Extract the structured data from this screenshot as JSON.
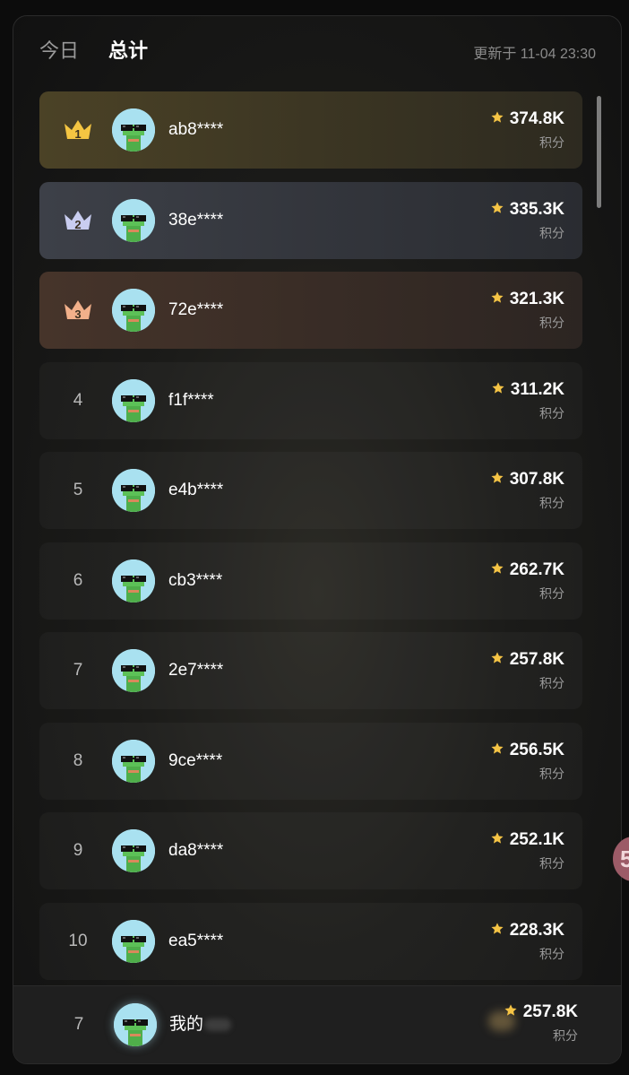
{
  "header": {
    "tabs": [
      {
        "label": "今日"
      },
      {
        "label": "总计"
      }
    ],
    "updated": "更新于 11-04 23:30"
  },
  "score_unit": "积分",
  "entries": [
    {
      "rank": "1",
      "name": "ab8****",
      "score": "374.8K"
    },
    {
      "rank": "2",
      "name": "38e****",
      "score": "335.3K"
    },
    {
      "rank": "3",
      "name": "72e****",
      "score": "321.3K"
    },
    {
      "rank": "4",
      "name": "f1f****",
      "score": "311.2K"
    },
    {
      "rank": "5",
      "name": "e4b****",
      "score": "307.8K"
    },
    {
      "rank": "6",
      "name": "cb3****",
      "score": "262.7K"
    },
    {
      "rank": "7",
      "name": "2e7****",
      "score": "257.8K"
    },
    {
      "rank": "8",
      "name": "9ce****",
      "score": "256.5K"
    },
    {
      "rank": "9",
      "name": "da8****",
      "score": "252.1K"
    },
    {
      "rank": "10",
      "name": "ea5****",
      "score": "228.3K"
    }
  ],
  "me": {
    "rank": "7",
    "name": "我的",
    "score": "257.8K"
  },
  "side_badge": "5",
  "colors": {
    "gold": "#f4c542",
    "silver": "#c9cdf0",
    "bronze": "#f2b08a",
    "star": "#f5c445",
    "avatar_bg": "#a9e1f0"
  },
  "icons": {
    "crown": "crown-icon",
    "star": "star-icon",
    "avatar": "frog-avatar-icon"
  }
}
